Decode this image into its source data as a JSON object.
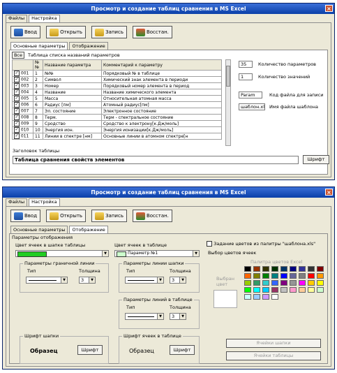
{
  "window": {
    "title": "Просмотр и создание таблиц сравнения в MS Excel",
    "close_glyph": "×"
  },
  "menu_tabs": [
    "Файлы",
    "Настройка"
  ],
  "toolbar": {
    "input_label": "Ввод",
    "open_label": "Открыть",
    "save_label": "Запись",
    "restore_label": "Восстан."
  },
  "subtabs": [
    "Основные параметры",
    "Отображение"
  ],
  "table": {
    "all_button": "Все",
    "caption": "Таблица списка названий параметров",
    "headers": [
      "№№",
      "Название параметра",
      "Комментарий к параметру"
    ],
    "rows": [
      {
        "code": "001",
        "num": "1",
        "name": "№№",
        "comment": "Порядковый № в таблице"
      },
      {
        "code": "002",
        "num": "2",
        "name": "Символ",
        "comment": "Химический знак элемента в периоди"
      },
      {
        "code": "003",
        "num": "3",
        "name": "Номер",
        "comment": "Порядковый номер элемента в период"
      },
      {
        "code": "004",
        "num": "4",
        "name": "Название",
        "comment": "Название химического элемента"
      },
      {
        "code": "005",
        "num": "5",
        "name": "Масса",
        "comment": "Относительная атомная масса"
      },
      {
        "code": "006",
        "num": "6",
        "name": "Радиус [пм]",
        "comment": "Атомный радиус[пм]"
      },
      {
        "code": "007",
        "num": "7",
        "name": "Эл. состояние",
        "comment": "Электронное состояние"
      },
      {
        "code": "008",
        "num": "8",
        "name": "Терм.",
        "comment": "Терм - спектральное состояние"
      },
      {
        "code": "009",
        "num": "9",
        "name": "Сродство",
        "comment": "Сродство к электрону[к.Дж/моль]"
      },
      {
        "code": "010",
        "num": "10",
        "name": "Энергия ион.",
        "comment": "Энергия ионизации[к.Дж/моль]"
      },
      {
        "code": "011",
        "num": "11",
        "name": "Линии в спектре [нм]",
        "comment": "Основные линии в атомном спектре[н"
      }
    ]
  },
  "params": {
    "param_count": "35",
    "param_count_label": "Количество параметров",
    "value_count": "1",
    "value_count_label": "Количество значений",
    "file_code": "Param",
    "file_code_label": "Код файла для записи",
    "template_file": "шаблон.xls",
    "template_file_label": "Имя файла шаблона"
  },
  "header_section": {
    "label": "Заголовок таблицы",
    "value": "Таблица сравнения свойств элементов",
    "font_button": "Шрифт"
  },
  "display": {
    "group_title": "Параметры отображения",
    "header_color_label": "Цвет ячеек в шапке таблицы",
    "table_color_label": "Цвет ячеек в таблице",
    "table_color_value": "Параметр №1",
    "header_line_title": "Параметры граничной линии",
    "line_header_title": "Параметры линии шапки",
    "line_table_title": "Параметры линий в таблице",
    "type_label": "Тип",
    "thickness_label": "Толщина",
    "thickness_value": "3",
    "header_font_title": "Шрифт шапки",
    "table_font_title": "Шрифт ячеек в таблице",
    "sample_bold": "Образец",
    "sample_regular": "Образец",
    "font_button": "Шрифт",
    "palette_checkbox": "Задание цветов из палитры \"шаблона.xls\"",
    "cell_color_choice": "Выбор цветов ячеек",
    "palette_title": "Палитра цветов Excel",
    "selected_color_label": "Выбран цвет",
    "header_cells_button": "Ячейки шапки",
    "table_cells_button": "Ячейки таблицы"
  },
  "colors": {
    "header_cell_green": "#22cc22",
    "table_cell_green": "#ccffcc",
    "palette": [
      "#000000",
      "#993300",
      "#333300",
      "#003300",
      "#003366",
      "#000080",
      "#333399",
      "#333333",
      "#800000",
      "#ff6600",
      "#808000",
      "#008000",
      "#008080",
      "#0000ff",
      "#666699",
      "#808080",
      "#ff0000",
      "#ff9900",
      "#99cc00",
      "#339966",
      "#33cccc",
      "#3366ff",
      "#800080",
      "#969696",
      "#ff00ff",
      "#ffcc00",
      "#ffff00",
      "#00ff00",
      "#00ffff",
      "#00ccff",
      "#993366",
      "#c0c0c0",
      "#ff99cc",
      "#ffcc99",
      "#ffff99",
      "#ccffcc",
      "#ccffff",
      "#99ccff",
      "#cc99ff",
      "#ffffff"
    ]
  }
}
